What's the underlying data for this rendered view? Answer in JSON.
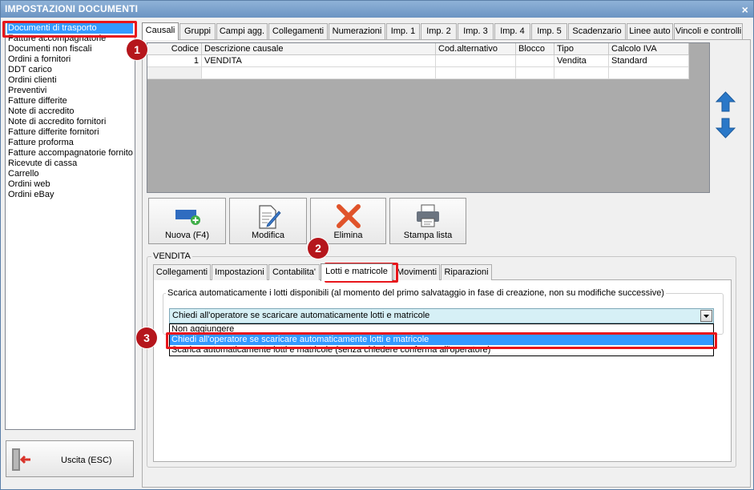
{
  "window": {
    "title": "IMPOSTAZIONI DOCUMENTI",
    "close_glyph": "×"
  },
  "doc_list": [
    "Documenti di trasporto",
    "Fatture accompagnatorie",
    "Documenti non fiscali",
    "Ordini a fornitori",
    "DDT carico",
    "Ordini clienti",
    "Preventivi",
    "Fatture differite",
    "Note di accredito",
    "Note di accredito fornitori",
    "Fatture differite fornitori",
    "Fatture proforma",
    "Fatture accompagnatorie fornito",
    "Ricevute di cassa",
    "Carrello",
    "Ordini web",
    "Ordini eBay"
  ],
  "exit_button": {
    "label": "Uscita (ESC)",
    "icon": "exit-door-icon"
  },
  "top_tabs": [
    "Causali",
    "Gruppi",
    "Campi agg.",
    "Collegamenti",
    "Numerazioni",
    "Imp. 1",
    "Imp. 2",
    "Imp. 3",
    "Imp. 4",
    "Imp. 5",
    "Scadenzario",
    "Linee auto",
    "Vincoli e controlli"
  ],
  "grid": {
    "columns": [
      "Codice",
      "Descrizione causale",
      "Cod.alternativo",
      "Blocco",
      "Tipo",
      "Calcolo IVA"
    ],
    "rows": [
      [
        "1",
        "VENDITA",
        "",
        "",
        "Vendita",
        "Standard"
      ]
    ]
  },
  "actions": {
    "new": "Nuova (F4)",
    "edit": "Modifica",
    "delete": "Elimina",
    "print": "Stampa lista"
  },
  "group": {
    "title": "VENDITA",
    "tabs": [
      "Collegamenti",
      "Impostazioni",
      "Contabilita'",
      "Lotti e matricole",
      "Movimenti",
      "Riparazioni"
    ],
    "sub_label": "Scarica automaticamente i lotti disponibili (al momento del primo salvataggio in fase di creazione, non su modifiche successive)",
    "combo_value": "Chiedi all'operatore se scaricare automaticamente lotti e matricole",
    "options": [
      "Non aggiungere",
      "Chiedi all'operatore se scaricare automaticamente lotti e matricole",
      "Scarica automaticamente lotti e matricole (senza chiedere conferma all'operatore)"
    ]
  },
  "badges": [
    "1",
    "2",
    "3"
  ],
  "colors": {
    "highlight": "#e8161b",
    "badge": "#b5161c",
    "selection": "#3399ff",
    "delete_x": "#e0532a",
    "arrow": "#2a78c8"
  }
}
